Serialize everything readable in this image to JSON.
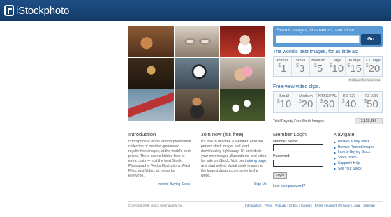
{
  "header": {
    "logo_text": "iStockphoto"
  },
  "mosaic": {
    "tiles": 9
  },
  "search": {
    "label": "Search Images, Illustrations, and Video",
    "input_value": "",
    "go_label": "Go"
  },
  "images": {
    "heading": "The world's best images, for as little as:",
    "sizes": [
      {
        "name": "XSmall",
        "price": "1"
      },
      {
        "name": "Small",
        "price": "3"
      },
      {
        "name": "Medium",
        "price": "5"
      },
      {
        "name": "Large",
        "price": "10"
      },
      {
        "name": "XLarge",
        "price": "15"
      },
      {
        "name": "XXLarge",
        "price": "20"
      }
    ],
    "rollover_note": "Roll over for more info"
  },
  "video": {
    "heading": "Free-view video clips.",
    "sizes": [
      {
        "name": "Small",
        "price": "10"
      },
      {
        "name": "Medium",
        "price": "20"
      },
      {
        "name": "NTSC/PAL",
        "price": "30"
      },
      {
        "name": "HD 720",
        "price": "40"
      },
      {
        "name": "HD 1080",
        "price": "50"
      }
    ]
  },
  "currency_symbol": "$",
  "totals": {
    "label": "Total Royalty-Free Stock Images:",
    "count": "3,129,886"
  },
  "intro": {
    "heading": "Introduction",
    "text": "iStockphoto® is the world's preeminent collection of member-generated royalty-free images, at the world's best prices. There are no hidden fees or extra costs — just the best Stock Photography, Vector Illustrations, Flash Files, and Video, at prices for everyone.",
    "link": "Intro to Buying Stock"
  },
  "join": {
    "heading": "Join now (it's free)",
    "text_a": "It's free to become a Member. Find the perfect stock image, and start downloading right away. Or contribute your own images, illustrations, and video, for sale on iStock. Visit our ",
    "text_link": "training page",
    "text_b": ", and start selling digital stock images to the largest design community in the world.",
    "signup": "Sign Up"
  },
  "login": {
    "heading": "Member Login",
    "member_label": "Member Name:",
    "member_value": "",
    "password_label": "Password:",
    "password_value": "",
    "button": "Login",
    "forgot": "Lost your password?"
  },
  "navigate": {
    "heading": "Navigate",
    "items": [
      "Browse & Buy Stock",
      "Browse Recent Images",
      "Intro to Buying Stock",
      "Stock Video",
      "Support / Help",
      "Sell Your Stock"
    ]
  },
  "footer": {
    "copyright": "Copyright 2008 iStock International Inc.",
    "links": [
      "Introduction",
      "Press",
      "Popular",
      "Critics",
      "Careers",
      "FAQs",
      "Support",
      "Privacy",
      "Legal",
      "Sitemap"
    ]
  }
}
